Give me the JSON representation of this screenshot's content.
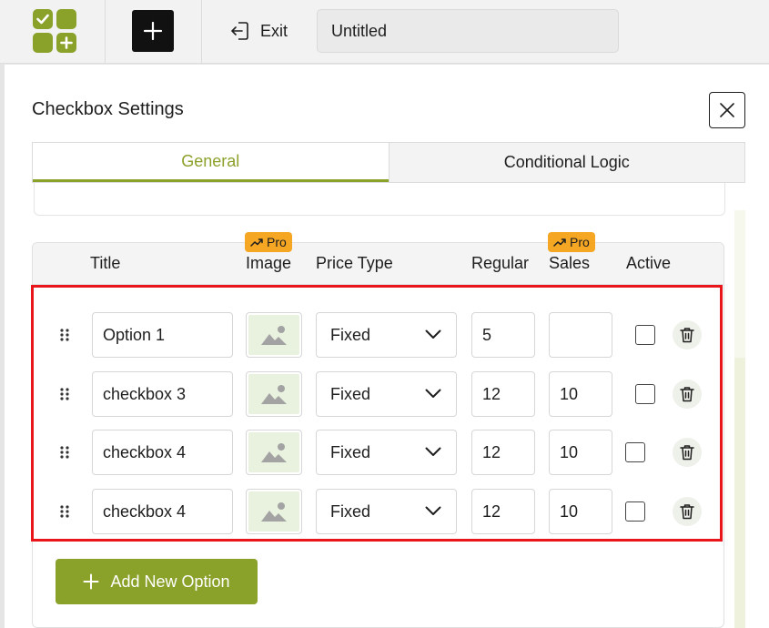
{
  "topbar": {
    "exit_label": "Exit",
    "title_value": "Untitled"
  },
  "modal": {
    "title": "Checkbox Settings",
    "tabs": [
      {
        "label": "General",
        "active": true
      },
      {
        "label": "Conditional Logic",
        "active": false
      }
    ]
  },
  "options_table": {
    "columns": {
      "title": "Title",
      "image": "Image",
      "price_type": "Price Type",
      "regular": "Regular",
      "sales": "Sales",
      "active": "Active"
    },
    "pro_badge": "Pro",
    "rows": [
      {
        "title": "Option 1",
        "price_type": "Fixed",
        "regular": "5",
        "sales": "",
        "active": false
      },
      {
        "title": "checkbox 3",
        "price_type": "Fixed",
        "regular": "12",
        "sales": "10",
        "active": false
      },
      {
        "title": "checkbox 4",
        "price_type": "Fixed",
        "regular": "12",
        "sales": "10",
        "active": false
      },
      {
        "title": "checkbox 4",
        "price_type": "Fixed",
        "regular": "12",
        "sales": "10",
        "active": false
      }
    ],
    "add_button_label": "Add New Option"
  },
  "colors": {
    "accent": "#8aa12a",
    "highlight": "#e8161b",
    "pro_badge": "#f5a623"
  },
  "icons": [
    "logo-icon",
    "plus-icon",
    "exit-icon",
    "close-icon",
    "drag-handle-icon",
    "image-placeholder-icon",
    "chevron-down-icon",
    "trash-icon",
    "trending-up-icon"
  ]
}
